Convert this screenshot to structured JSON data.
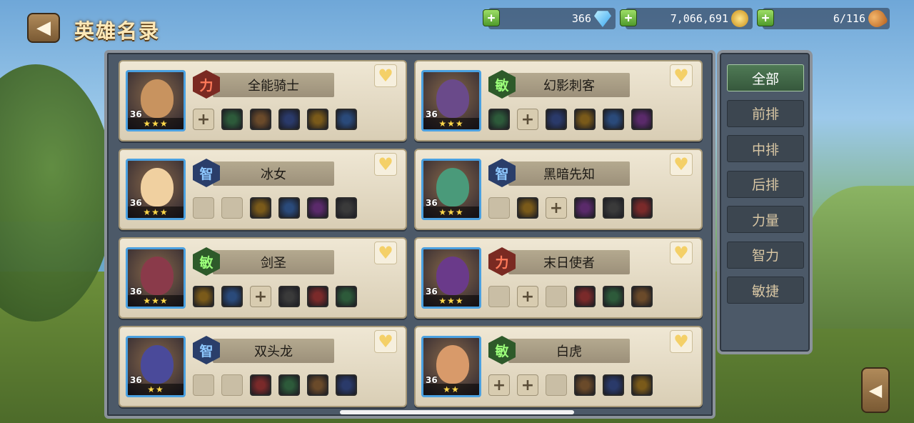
{
  "title": "英雄名录",
  "resources": {
    "gems": "366",
    "gold": "7,066,691",
    "stamina": "6/116"
  },
  "icons": {
    "back": "arrow-left-icon",
    "plus": "plus-icon",
    "gem": "diamond-icon",
    "gold": "gold-coins-icon",
    "stamina": "meat-drumstick-icon",
    "favorite": "heart-icon"
  },
  "heroes": [
    {
      "name": "全能骑士",
      "attr": "力",
      "level": "36",
      "stars": "★★★",
      "equip": [
        "+",
        "item",
        "item",
        "item",
        "item",
        "item"
      ]
    },
    {
      "name": "幻影刺客",
      "attr": "敏",
      "level": "36",
      "stars": "★★★",
      "equip": [
        "item",
        "+",
        "item",
        "item",
        "item",
        "item"
      ]
    },
    {
      "name": "冰女",
      "attr": "智",
      "level": "36",
      "stars": "★★★",
      "equip": [
        "empty",
        "empty",
        "item",
        "item",
        "item",
        "item"
      ]
    },
    {
      "name": "黑暗先知",
      "attr": "智",
      "level": "36",
      "stars": "★★★",
      "equip": [
        "empty",
        "item",
        "+",
        "item",
        "item",
        "item"
      ]
    },
    {
      "name": "剑圣",
      "attr": "敏",
      "level": "36",
      "stars": "★★★",
      "equip": [
        "item",
        "item",
        "+",
        "item",
        "item",
        "item"
      ]
    },
    {
      "name": "末日使者",
      "attr": "力",
      "level": "36",
      "stars": "★★★",
      "equip": [
        "empty",
        "+",
        "empty",
        "item",
        "item",
        "item"
      ]
    },
    {
      "name": "双头龙",
      "attr": "智",
      "level": "36",
      "stars": "★★",
      "equip": [
        "empty",
        "empty",
        "item",
        "item",
        "item",
        "item"
      ]
    },
    {
      "name": "白虎",
      "attr": "敏",
      "level": "36",
      "stars": "★★",
      "equip": [
        "+",
        "+",
        "empty",
        "item",
        "item",
        "item"
      ]
    }
  ],
  "filters": [
    "全部",
    "前排",
    "中排",
    "后排",
    "力量",
    "智力",
    "敏捷"
  ],
  "active_filter": "全部"
}
